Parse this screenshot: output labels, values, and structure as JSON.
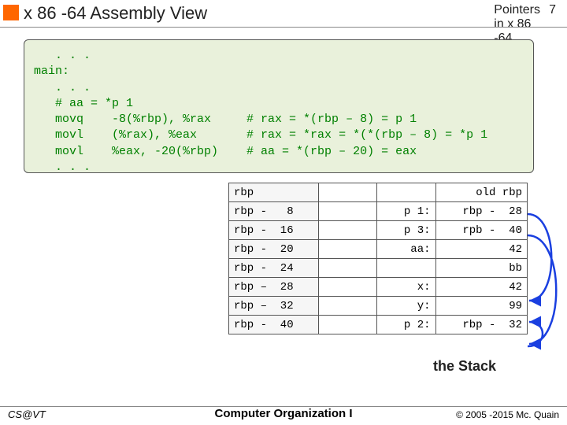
{
  "header": {
    "title": "x 86 -64 Assembly View",
    "topic": "Pointers in x 86 -64",
    "pagenum": "7"
  },
  "code": "   . . .\nmain:\n   . . .\n   # aa = *p 1\n   movq    -8(%rbp), %rax     # rax = *(rbp – 8) = p 1\n   movl    (%rax), %eax       # rax = *rax = *(*(rbp – 8) = *p 1\n   movl    %eax, -20(%rbp)    # aa = *(rbp – 20) = eax\n   . . .",
  "stack": {
    "rows": [
      {
        "addr": "rbp",
        "label": "",
        "value": "old rbp"
      },
      {
        "addr": "rbp -   8",
        "label": "p 1:",
        "value": "rbp -  28"
      },
      {
        "addr": "rbp -  16",
        "label": "p 3:",
        "value": "rpb -  40"
      },
      {
        "addr": "rbp -  20",
        "label": "aa:",
        "value": "42"
      },
      {
        "addr": "rbp -  24",
        "label": "",
        "value": "bb"
      },
      {
        "addr": "rbp –  28",
        "label": "x:",
        "value": "42"
      },
      {
        "addr": "rbp –  32",
        "label": "y:",
        "value": "99"
      },
      {
        "addr": "rbp -  40",
        "label": "p 2:",
        "value": "rbp -  32"
      }
    ],
    "caption": "the Stack"
  },
  "footer": {
    "left": "CS@VT",
    "center": "Computer Organization I",
    "right": "© 2005 -2015 Mc. Quain"
  }
}
